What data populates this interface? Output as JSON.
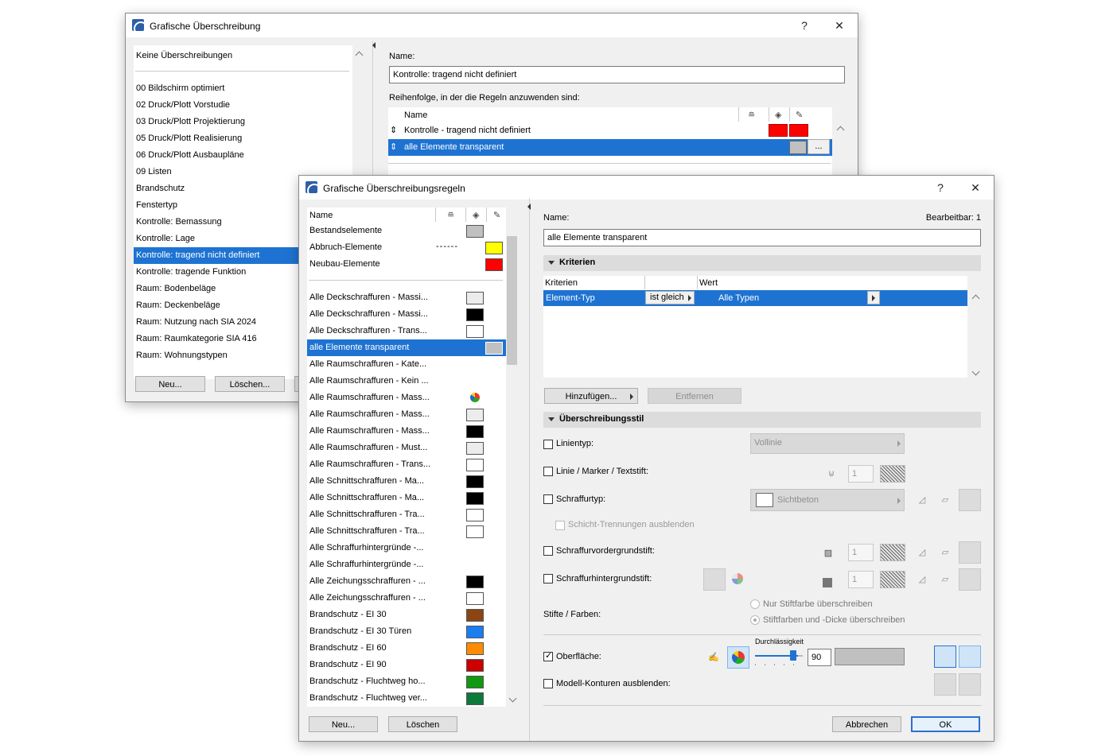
{
  "win1": {
    "title": "Grafische Überschreibung",
    "help": "?",
    "close": "✕",
    "list_header": "Keine Überschreibungen",
    "list_items": [
      "00 Bildschirm optimiert",
      "02 Druck/Plott Vorstudie",
      "03 Druck/Plott Projektierung",
      "05 Druck/Plott Realisierung",
      "06 Druck/Plott Ausbaupläne",
      "09 Listen",
      "Brandschutz",
      "Fenstertyp",
      "Kontrolle: Bemassung",
      "Kontrolle: Lage",
      "Kontrolle: tragend nicht definiert",
      "Kontrolle: tragende Funktion",
      "Raum: Bodenbeläge",
      "Raum: Deckenbeläge",
      "Raum: Nutzung nach SIA 2024",
      "Raum: Raumkategorie SIA 416",
      "Raum: Wohnungstypen"
    ],
    "selected_index": 10,
    "btn_new": "Neu...",
    "btn_delete": "Löschen...",
    "name_label": "Name:",
    "name_value": "Kontrolle: tragend nicht definiert",
    "order_label": "Reihenfolge, in der die Regeln anzuwenden sind:",
    "rules_header": "Name",
    "rules": [
      {
        "name": "Kontrolle - tragend nicht definiert",
        "colors": [
          "#ff0000",
          "#ff0000"
        ]
      },
      {
        "name": "alle Elemente transparent",
        "colors": [
          "#c0c0c0"
        ],
        "more": "..."
      }
    ],
    "sort_glyph": "⇕"
  },
  "win2": {
    "title": "Grafische Überschreibungsregeln",
    "help": "?",
    "close": "✕",
    "list_header": "Name",
    "top_items": [
      {
        "name": "Bestandselemente",
        "color": "#c0c0c0"
      },
      {
        "name": "Abbruch-Elemente",
        "color": "#ffff00",
        "line": "------"
      },
      {
        "name": "Neubau-Elemente",
        "color": "#ff0000"
      }
    ],
    "items": [
      {
        "name": "Alle Deckschraffuren - Massi...",
        "color": "#ececec"
      },
      {
        "name": "Alle Deckschraffuren - Massi...",
        "color": "#000000"
      },
      {
        "name": "Alle Deckschraffuren - Trans...",
        "color": "#ffffff"
      },
      {
        "name": "alle Elemente transparent",
        "color": "#c0c0c0",
        "selected": true
      },
      {
        "name": "Alle Raumschraffuren - Kate...",
        "color": ""
      },
      {
        "name": "Alle Raumschraffuren - Kein ...",
        "color": ""
      },
      {
        "name": "Alle Raumschraffuren - Mass...",
        "color": "pie"
      },
      {
        "name": "Alle Raumschraffuren - Mass...",
        "color": "#ececec"
      },
      {
        "name": "Alle Raumschraffuren - Mass...",
        "color": "#000000"
      },
      {
        "name": "Alle Raumschraffuren - Must...",
        "color": "#ececec"
      },
      {
        "name": "Alle Raumschraffuren - Trans...",
        "color": "#ffffff"
      },
      {
        "name": "Alle Schnittschraffuren - Ma...",
        "color": "#000000"
      },
      {
        "name": "Alle Schnittschraffuren - Ma...",
        "color": "#000000"
      },
      {
        "name": "Alle Schnittschraffuren - Tra...",
        "color": "#ffffff"
      },
      {
        "name": "Alle Schnittschraffuren - Tra...",
        "color": "#ffffff"
      },
      {
        "name": "Alle Schraffurhintergründe -...",
        "color": ""
      },
      {
        "name": "Alle Schraffurhintergründe -...",
        "color": ""
      },
      {
        "name": "Alle Zeichungsschraffuren - ...",
        "color": "#000000"
      },
      {
        "name": "Alle Zeichungsschraffuren - ...",
        "color": "#ffffff"
      },
      {
        "name": "Brandschutz - EI 30",
        "color": "#8b4513"
      },
      {
        "name": "Brandschutz - EI 30 Türen",
        "color": "#1a7ef0"
      },
      {
        "name": "Brandschutz - EI 60",
        "color": "#ff8c00"
      },
      {
        "name": "Brandschutz - EI 90",
        "color": "#cc0000"
      },
      {
        "name": "Brandschutz - Fluchtweg ho...",
        "color": "#119911"
      },
      {
        "name": "Brandschutz - Fluchtweg ver...",
        "color": "#0b7a3a"
      }
    ],
    "btn_new": "Neu...",
    "btn_delete": "Löschen",
    "name_label": "Name:",
    "editable_label": "Bearbeitbar: 1",
    "name_value": "alle Elemente transparent",
    "criteria_section": "Kriterien",
    "criteria_cols": [
      "Kriterien",
      "",
      "Wert"
    ],
    "criteria_row": {
      "criterion": "Element-Typ",
      "operator": "ist gleich",
      "value": "Alle Typen"
    },
    "btn_add": "Hinzufügen...",
    "btn_remove": "Entfernen",
    "style_section": "Überschreibungsstil",
    "linetype_label": "Linientyp:",
    "linetype_value": "Vollinie",
    "pen_label": "Linie / Marker / Textstift:",
    "pen_value": "1",
    "fill_label": "Schraffurtyp:",
    "fill_value": "Sichtbeton",
    "hide_layers_label": "Schicht-Trennungen ausblenden",
    "fg_label": "Schraffurvordergrundstift:",
    "fg_value": "1",
    "bg_label": "Schraffurhintergrundstift:",
    "bg_value": "1",
    "pens_label": "Stifte / Farben:",
    "radio1": "Nur Stiftfarbe überschreiben",
    "radio2": "Stiftfarben und -Dicke überschreiben",
    "transparency_label": "Durchlässigkeit",
    "transparency_value": "90",
    "surface_label": "Oberfläche:",
    "hide_contours_label": "Modell-Konturen ausblenden:",
    "btn_cancel": "Abbrechen",
    "btn_ok": "OK"
  },
  "colors": {
    "selection": "#1e73d2",
    "accent": "#2a6fd0"
  }
}
